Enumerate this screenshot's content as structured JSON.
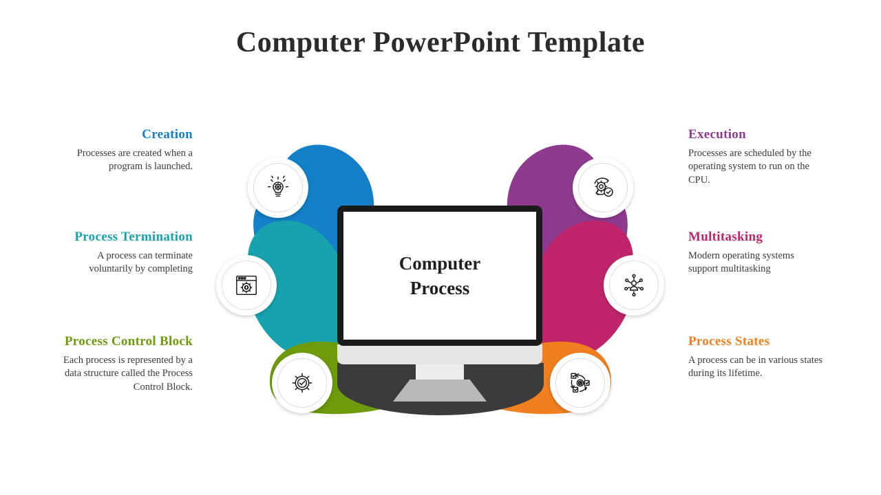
{
  "slide": {
    "title": "Computer PowerPoint Template",
    "center": {
      "line1": "Computer",
      "line2": "Process"
    }
  },
  "colors": {
    "creation": "#1380C8",
    "termination": "#18A2AE",
    "process_control_block": "#6E9B0C",
    "execution": "#8E3A8E",
    "multitasking": "#C0256B",
    "process_states": "#F07F1F",
    "title": "#2b2b2b",
    "body": "#3b3b3b",
    "monitor_bezel": "#1a1a1a",
    "screen": "#ffffff"
  },
  "items": {
    "creation": {
      "heading": "Creation",
      "body": "Processes are created when a program is launched.",
      "icon": "lightbulb-gear-icon"
    },
    "termination": {
      "heading": "Process Termination",
      "body": "A process can terminate voluntarily by completing",
      "icon": "browser-window-code-gear-icon"
    },
    "process_control_block": {
      "heading": "Process Control Block",
      "body": "Each process is represented by a data structure called the Process Control Block.",
      "icon": "gear-check-icon"
    },
    "execution": {
      "heading": "Execution",
      "body": "Processes are scheduled by the operating system to run on the CPU.",
      "icon": "gear-refresh-check-icon"
    },
    "multitasking": {
      "heading": "Multitasking",
      "body": "Modern operating systems support multitasking",
      "icon": "person-network-icon"
    },
    "process_states": {
      "heading": "Process States",
      "body": "A process can be in various states during its lifetime.",
      "icon": "checkbox-cycle-gear-icon"
    }
  }
}
